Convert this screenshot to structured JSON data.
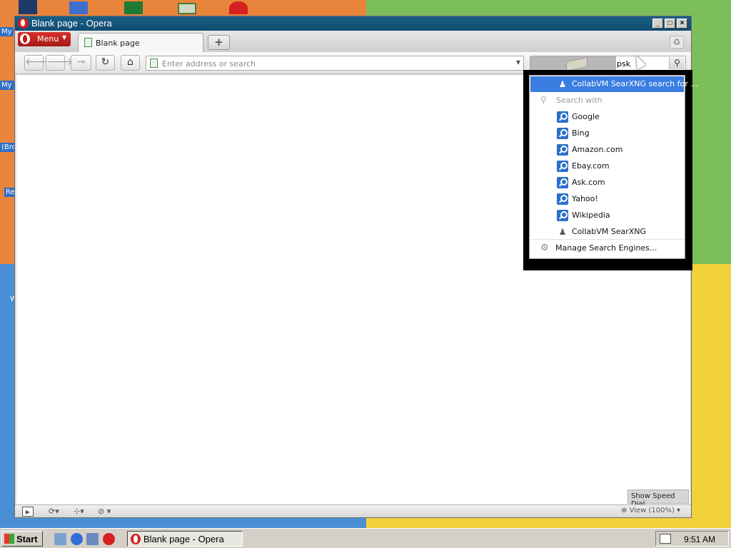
{
  "window": {
    "title": "Blank page - Opera",
    "controls": {
      "minimize": "_",
      "maximize": "□",
      "close": "×"
    }
  },
  "tabstrip": {
    "menu_label": "Menu",
    "tab_title": "Blank page",
    "new_tab_symbol": "+"
  },
  "toolbar": {
    "address_placeholder": "Enter address or search",
    "search_value": "psk"
  },
  "search_dropdown": {
    "suggestion": "CollabVM SearXNG search for ...",
    "search_with_label": "Search with",
    "engines": [
      {
        "name": "Google",
        "icon": "search-icon"
      },
      {
        "name": "Bing",
        "icon": "search-icon"
      },
      {
        "name": "Amazon.com",
        "icon": "search-icon"
      },
      {
        "name": "Ebay.com",
        "icon": "search-icon"
      },
      {
        "name": "Ask.com",
        "icon": "search-icon"
      },
      {
        "name": "Yahoo!",
        "icon": "search-icon"
      },
      {
        "name": "Wikipedia",
        "icon": "search-icon"
      },
      {
        "name": "CollabVM SearXNG",
        "icon": "robot-icon"
      }
    ],
    "manage_label": "Manage Search Engines..."
  },
  "content": {
    "speed_dial_label": "Show Speed Dial"
  },
  "statusbar": {
    "zoom_label": "View (100%)"
  },
  "desktop": {
    "labels": [
      "My",
      "My I",
      "(Bro",
      "Re",
      "W"
    ]
  },
  "taskbar": {
    "start_label": "Start",
    "task_label": "Blank page - Opera",
    "clock": "9:51 AM"
  },
  "colors": {
    "titlebar": "#0f4b70",
    "selection": "#3b7de0",
    "menu_red": "#c01c18"
  }
}
